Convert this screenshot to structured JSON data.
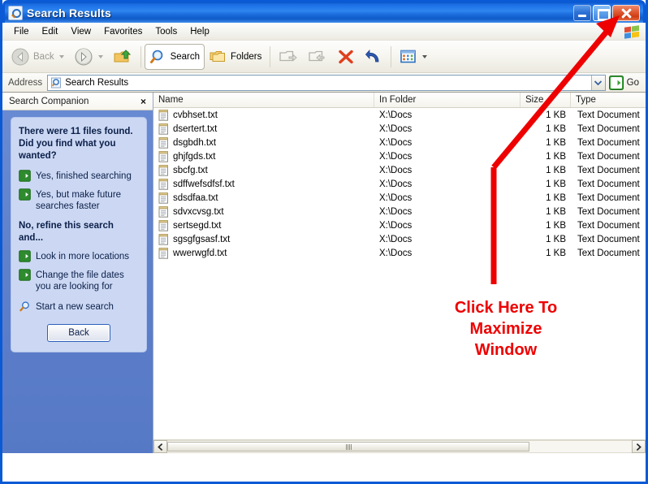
{
  "window": {
    "title": "Search Results",
    "icon": "search-document-icon",
    "minimize_label": "Minimize",
    "maximize_label": "Maximize",
    "close_label": "Close"
  },
  "menubar": {
    "items": [
      {
        "label": "File"
      },
      {
        "label": "Edit"
      },
      {
        "label": "View"
      },
      {
        "label": "Favorites"
      },
      {
        "label": "Tools"
      },
      {
        "label": "Help"
      }
    ],
    "logo": "windows-flag-logo"
  },
  "toolbar": {
    "back_label": "Back",
    "forward_label": "Forward",
    "up_label": "Up",
    "search_label": "Search",
    "folders_label": "Folders",
    "move_to_label": "Move To",
    "copy_to_label": "Copy To",
    "delete_label": "Delete",
    "undo_label": "Undo",
    "views_label": "Views"
  },
  "address": {
    "label": "Address",
    "value": "Search Results",
    "icon": "search-document-icon",
    "go_label": "Go"
  },
  "search_companion": {
    "title": "Search Companion",
    "close_label": "×",
    "headline": "There were 11 files found. Did you find what you wanted?",
    "links_yes": [
      {
        "label": "Yes, finished searching",
        "icon": "green-arrow-icon"
      },
      {
        "label": "Yes, but make future searches faster",
        "icon": "green-arrow-icon"
      }
    ],
    "subhead": "No, refine this search and...",
    "links_refine": [
      {
        "label": "Look in more locations",
        "icon": "green-arrow-icon"
      },
      {
        "label": "Change the file dates you are looking for",
        "icon": "green-arrow-icon"
      },
      {
        "label": "Start a new search",
        "icon": "magnifier-icon"
      }
    ],
    "back_button": "Back"
  },
  "results": {
    "columns": [
      "Name",
      "In Folder",
      "Size",
      "Type"
    ],
    "rows": [
      {
        "name": "cvbhset.txt",
        "folder": "X:\\Docs",
        "size": "1 KB",
        "type": "Text Document"
      },
      {
        "name": "dsertert.txt",
        "folder": "X:\\Docs",
        "size": "1 KB",
        "type": "Text Document"
      },
      {
        "name": "dsgbdh.txt",
        "folder": "X:\\Docs",
        "size": "1 KB",
        "type": "Text Document"
      },
      {
        "name": "ghjfgds.txt",
        "folder": "X:\\Docs",
        "size": "1 KB",
        "type": "Text Document"
      },
      {
        "name": "sbcfg.txt",
        "folder": "X:\\Docs",
        "size": "1 KB",
        "type": "Text Document"
      },
      {
        "name": "sdffwefsdfsf.txt",
        "folder": "X:\\Docs",
        "size": "1 KB",
        "type": "Text Document"
      },
      {
        "name": "sdsdfaa.txt",
        "folder": "X:\\Docs",
        "size": "1 KB",
        "type": "Text Document"
      },
      {
        "name": "sdvxcvsg.txt",
        "folder": "X:\\Docs",
        "size": "1 KB",
        "type": "Text Document"
      },
      {
        "name": "sertsegd.txt",
        "folder": "X:\\Docs",
        "size": "1 KB",
        "type": "Text Document"
      },
      {
        "name": "sgsgfgsasf.txt",
        "folder": "X:\\Docs",
        "size": "1 KB",
        "type": "Text Document"
      },
      {
        "name": "wwerwgfd.txt",
        "folder": "X:\\Docs",
        "size": "1 KB",
        "type": "Text Document"
      }
    ]
  },
  "scrollbar": {
    "left_label": "Scroll left",
    "right_label": "Scroll right"
  },
  "annotation": {
    "text_line1": "Click Here To",
    "text_line2": "Maximize",
    "text_line3": "Window",
    "color": "#EE0000",
    "arrow": "red-arrow-to-maximize-button"
  },
  "colors": {
    "title_bar_blue": "#1f74e8",
    "window_border": "#0A5AD6",
    "companion_panel": "#5F80CB",
    "companion_card": "#CCD8F3",
    "annotation_red": "#EE0000",
    "go_green": "#2E9E2E"
  }
}
